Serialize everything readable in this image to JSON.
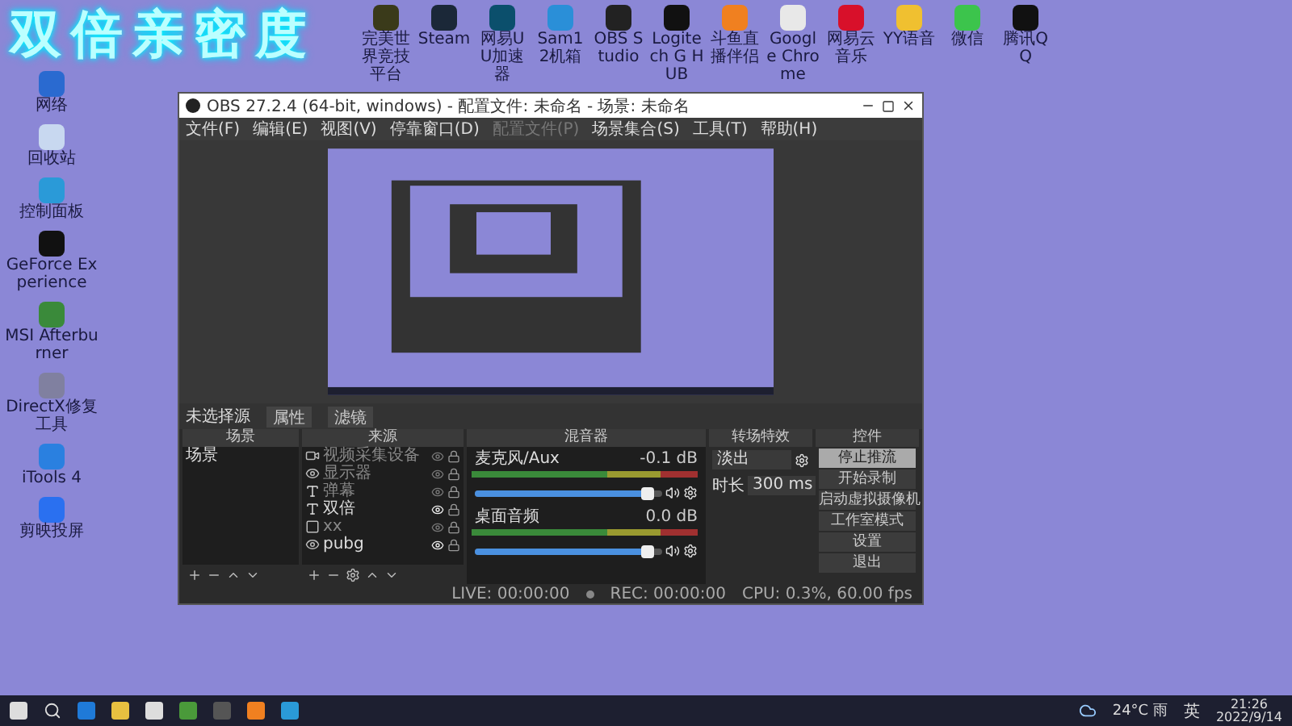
{
  "overlay_title": "双倍亲密度",
  "top_icons": [
    {
      "label": "完美世界竞技平台"
    },
    {
      "label": "Steam"
    },
    {
      "label": "网易UU加速器"
    },
    {
      "label": "Sam12机箱"
    },
    {
      "label": "OBS Studio"
    },
    {
      "label": "Logitech G HUB"
    },
    {
      "label": "斗鱼直播伴侣"
    },
    {
      "label": "Google Chrome"
    },
    {
      "label": "网易云音乐"
    },
    {
      "label": "YY语音"
    },
    {
      "label": "微信"
    },
    {
      "label": "腾讯QQ"
    }
  ],
  "left_icons": [
    {
      "label": "网络"
    },
    {
      "label": "回收站"
    },
    {
      "label": "控制面板"
    },
    {
      "label": "GeForce Experience"
    },
    {
      "label": "MSI Afterburner"
    },
    {
      "label": "DirectX修复工具"
    },
    {
      "label": "iTools 4"
    },
    {
      "label": "剪映投屏"
    }
  ],
  "window": {
    "title": "OBS 27.2.4 (64-bit, windows) - 配置文件: 未命名 - 场景: 未命名",
    "menu": [
      {
        "label": "文件(F)",
        "disabled": false
      },
      {
        "label": "编辑(E)",
        "disabled": false
      },
      {
        "label": "视图(V)",
        "disabled": false
      },
      {
        "label": "停靠窗口(D)",
        "disabled": false
      },
      {
        "label": "配置文件(P)",
        "disabled": true
      },
      {
        "label": "场景集合(S)",
        "disabled": false
      },
      {
        "label": "工具(T)",
        "disabled": false
      },
      {
        "label": "帮助(H)",
        "disabled": false
      }
    ],
    "source_bar": {
      "label": "未选择源",
      "buttons": [
        "属性",
        "滤镜"
      ]
    },
    "scenes": {
      "title": "场景",
      "items": [
        {
          "label": "场景",
          "selected": false
        }
      ]
    },
    "sources": {
      "title": "来源",
      "items": [
        {
          "label": "视频采集设备",
          "kind": "camera",
          "visible": false
        },
        {
          "label": "显示器",
          "kind": "game",
          "visible": false
        },
        {
          "label": "弹幕",
          "kind": "text",
          "visible": false
        },
        {
          "label": "双倍",
          "kind": "text",
          "visible": true
        },
        {
          "label": "xx",
          "kind": "window",
          "visible": false
        },
        {
          "label": "pubg",
          "kind": "game",
          "visible": true
        }
      ]
    },
    "mixer": {
      "title": "混音器",
      "channels": [
        {
          "name": "麦克风/Aux",
          "reading": "-0.1 dB",
          "level": 0.92
        },
        {
          "name": "桌面音频",
          "reading": "0.0 dB",
          "level": 0.92
        }
      ]
    },
    "transitions": {
      "title": "转场特效",
      "select": "淡出",
      "duration_label": "时长",
      "duration": "300 ms"
    },
    "controls": {
      "title": "控件",
      "buttons": [
        {
          "label": "停止推流",
          "highlighted": true
        },
        {
          "label": "开始录制",
          "highlighted": false
        },
        {
          "label": "启动虚拟摄像机",
          "highlighted": false
        },
        {
          "label": "工作室模式",
          "highlighted": false
        },
        {
          "label": "设置",
          "highlighted": false
        },
        {
          "label": "退出",
          "highlighted": false
        }
      ]
    },
    "status": {
      "live": "LIVE: 00:00:00",
      "rec": "REC: 00:00:00",
      "cpu": "CPU: 0.3%, 60.00 fps"
    }
  },
  "taskbar": {
    "weather": "24°C 雨",
    "ime": "英",
    "time": "21:26",
    "date": "2022/9/14"
  }
}
